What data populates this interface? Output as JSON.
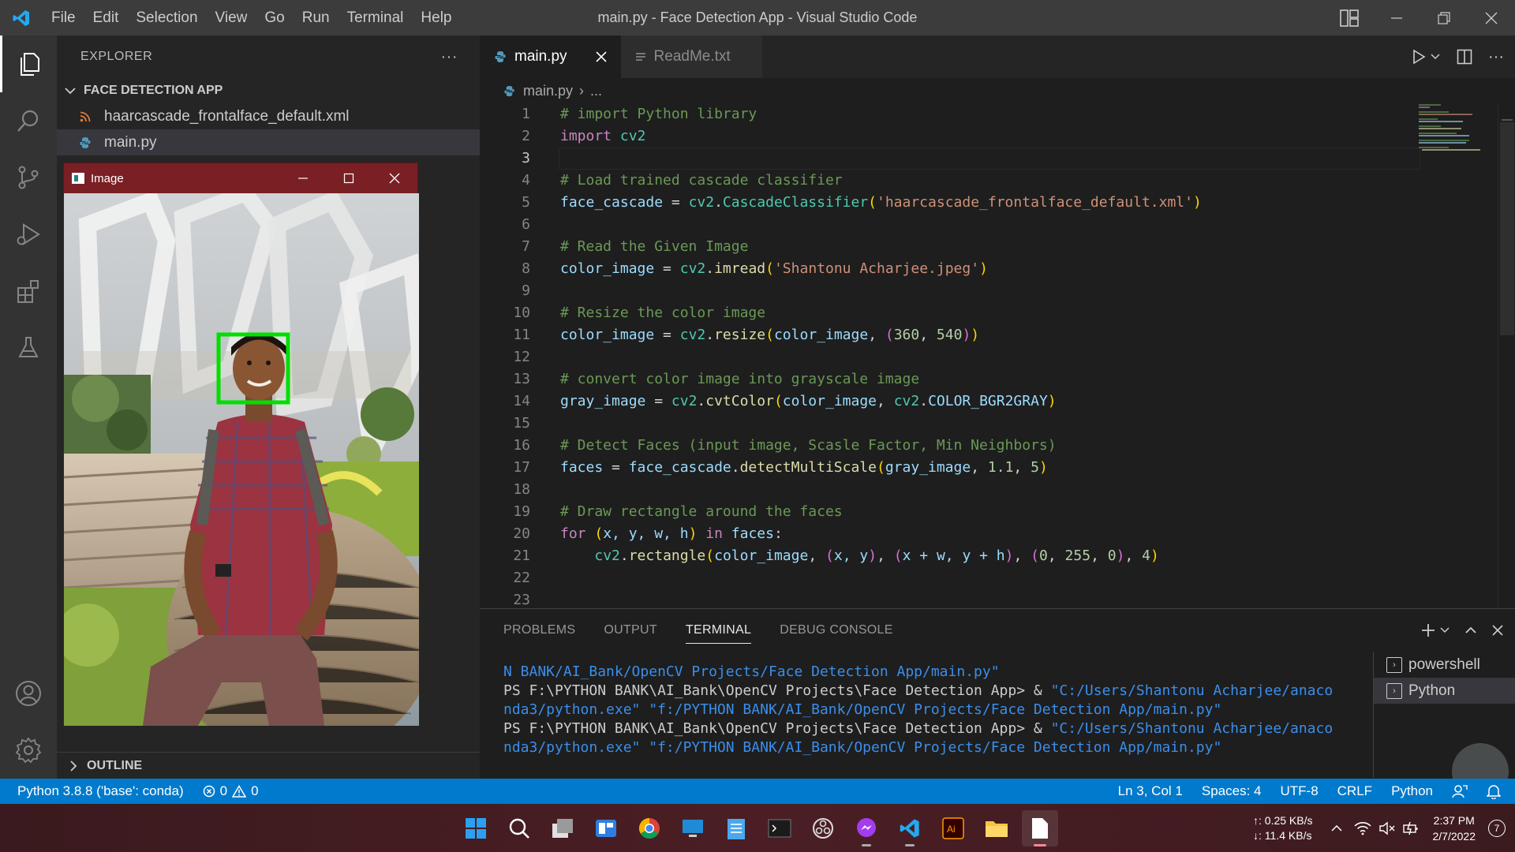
{
  "window": {
    "title": "main.py - Face Detection App - Visual Studio Code",
    "menu": [
      "File",
      "Edit",
      "Selection",
      "View",
      "Go",
      "Run",
      "Terminal",
      "Help"
    ]
  },
  "sidebar": {
    "header": "EXPLORER",
    "more": "···",
    "project": "FACE DETECTION APP",
    "files": [
      {
        "name": "haarcascade_frontalface_default.xml",
        "icon": "rss-icon"
      },
      {
        "name": "main.py",
        "icon": "python-icon"
      }
    ],
    "outline": "OUTLINE"
  },
  "image_window": {
    "title": "Image",
    "detection_color": "#00e000"
  },
  "tabs": [
    {
      "label": "main.py",
      "active": true
    },
    {
      "label": "ReadMe.txt",
      "active": false
    }
  ],
  "breadcrumb": {
    "file": "main.py",
    "rest": "..."
  },
  "code": {
    "l1": "# import Python library",
    "l2_kw": "import",
    "l2_mod": "cv2",
    "l4": "# Load trained cascade classifier",
    "l5_var": "face_cascade",
    "l5_mod": "cv2",
    "l5_fn": "CascadeClassifier",
    "l5_str": "'haarcascade_frontalface_default.xml'",
    "l7": "# Read the Given Image",
    "l8_var": "color_image",
    "l8_mod": "cv2",
    "l8_fn": "imread",
    "l8_str": "'Shantonu Acharjee.jpeg'",
    "l10": "# Resize the color image",
    "l11_var": "color_image",
    "l11_mod": "cv2",
    "l11_fn": "resize",
    "l11_arg": "color_image",
    "l11_n1": "360",
    "l11_n2": "540",
    "l13": "# convert color image into grayscale image",
    "l14_var": "gray_image",
    "l14_mod": "cv2",
    "l14_fn": "cvtColor",
    "l14_arg": "color_image",
    "l14_mod2": "cv2",
    "l14_const": "COLOR_BGR2GRAY",
    "l16": "# Detect Faces (input image, Scasle Factor, Min Neighbors)",
    "l17_var": "faces",
    "l17_obj": "face_cascade",
    "l17_fn": "detectMultiScale",
    "l17_arg": "gray_image",
    "l17_n1": "1.1",
    "l17_n2": "5",
    "l19": "# Draw rectangle around the faces",
    "l20_kw": "for",
    "l20_in": "in",
    "l20_vars": "x, y, w, h",
    "l20_iter": "faces",
    "l21_mod": "cv2",
    "l21_fn": "rectangle",
    "l21_arg": "color_image",
    "l21_xy": "x, y",
    "l21_x2": "x + w, y + h",
    "l21_n1": "0",
    "l21_n2": "255",
    "l21_n3": "0",
    "l21_n4": "4"
  },
  "line_numbers": [
    "1",
    "2",
    "3",
    "4",
    "5",
    "6",
    "7",
    "8",
    "9",
    "10",
    "11",
    "12",
    "13",
    "14",
    "15",
    "16",
    "17",
    "18",
    "19",
    "20",
    "21",
    "22",
    "23"
  ],
  "panel": {
    "tabs": [
      "PROBLEMS",
      "OUTPUT",
      "TERMINAL",
      "DEBUG CONSOLE"
    ],
    "active_tab": "TERMINAL",
    "terminal": {
      "line0": "N BANK/AI_Bank/OpenCV Projects/Face Detection App/main.py\"",
      "prompt": "PS F:\\PYTHON BANK\\AI_Bank\\OpenCV Projects\\Face Detection App> & ",
      "cmd_a": "\"C:/Users/Shantonu Acharjee/anaco",
      "cmd_b": "nda3/python.exe\" \"f:/PYTHON BANK/AI_Bank/OpenCV Projects/Face Detection App/main.py\""
    },
    "terminals": [
      "powershell",
      "Python"
    ]
  },
  "statusbar": {
    "interpreter": "Python 3.8.8 ('base': conda)",
    "errors": "0",
    "warnings": "0",
    "position": "Ln 3, Col 1",
    "spaces": "Spaces: 4",
    "encoding": "UTF-8",
    "eol": "CRLF",
    "language": "Python"
  },
  "taskbar": {
    "upload": "↑: 0.25 KB/s",
    "download": "↓: 11.4 KB/s",
    "time": "2:37 PM",
    "date": "2/7/2022",
    "notifications": "7"
  },
  "colors": {
    "accent": "#007acc",
    "titlebar": "#3c3c3c",
    "editor_bg": "#1e1e1e"
  }
}
